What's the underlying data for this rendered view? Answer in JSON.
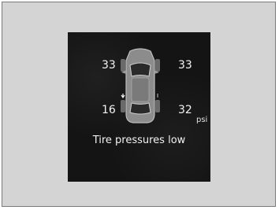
{
  "display": {
    "tires": {
      "front_left": "33",
      "front_right": "33",
      "rear_left": "16",
      "rear_right": "32"
    },
    "unit": "psi",
    "message": "Tire pressures low"
  },
  "icons": {
    "car": "car-top-view-icon",
    "low_indicator": "tire-low-indicator-icon"
  },
  "colors": {
    "screen_bg": "#141414",
    "text": "#f2f2f2",
    "frame_bg": "#d4d4d4"
  }
}
